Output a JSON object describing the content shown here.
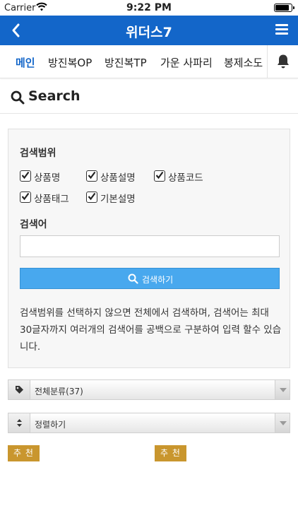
{
  "status": {
    "carrier": "Carrier",
    "time": "9:22 PM",
    "battery_level": 0.95
  },
  "header": {
    "title": "위더스7"
  },
  "tabs": [
    {
      "label": "메인",
      "active": true
    },
    {
      "label": "방진복OP",
      "active": false
    },
    {
      "label": "방진복TP",
      "active": false
    },
    {
      "label": "가운 사파리",
      "active": false
    },
    {
      "label": "봉제소도",
      "active": false
    }
  ],
  "search": {
    "heading": "Search",
    "scope_label": "검색범위",
    "scope_options": [
      {
        "label": "상품명",
        "checked": true
      },
      {
        "label": "상품설명",
        "checked": true
      },
      {
        "label": "상품코드",
        "checked": true
      },
      {
        "label": "상품태그",
        "checked": true
      },
      {
        "label": "기본설명",
        "checked": true
      }
    ],
    "keyword_label": "검색어",
    "keyword_value": "",
    "keyword_placeholder": "",
    "button_label": "검색하기",
    "info": "검색범위를 선택하지 않으면 전체에서 검색하며, 검색어는 최대 30글자까지 여러개의 검색어를 공백으로 구분하여 입력 할수 있습니다."
  },
  "category_select": {
    "value": "전체분류(37)",
    "icon": "tag-icon"
  },
  "sort_select": {
    "value": "정렬하기",
    "icon": "sort-icon"
  },
  "badges": [
    "추 천",
    "추 천"
  ],
  "colors": {
    "brand": "#1366c9",
    "button": "#48a8ee",
    "badge": "#c9962e"
  }
}
